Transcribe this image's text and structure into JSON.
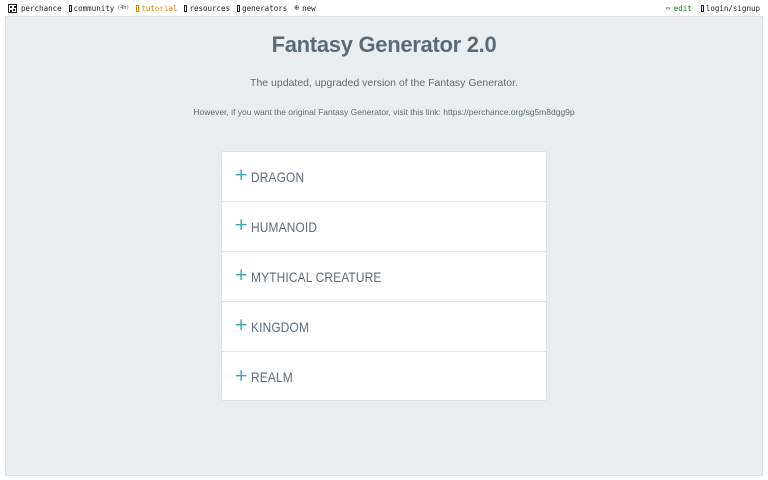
{
  "topbar": {
    "brand": "perchance",
    "community": "community",
    "community_badge": "(4h)",
    "tutorial": "tutorial",
    "resources": "resources",
    "generators": "generators",
    "new": "new",
    "edit": "edit",
    "login": "login/signup"
  },
  "page": {
    "title": "Fantasy Generator 2.0",
    "subtitle": "The updated, upgraded version of the Fantasy Generator.",
    "note_prefix": "However, if you want the original Fantasy Generator, visit this link: ",
    "note_link": "https://perchance.org/sg5m8dgg9p"
  },
  "accordion": {
    "items": [
      {
        "label": "DRAGON"
      },
      {
        "label": "HUMANOID"
      },
      {
        "label": "MYTHICAL CREATURE"
      },
      {
        "label": "KINGDOM"
      },
      {
        "label": "REALM"
      }
    ]
  },
  "colors": {
    "accent": "#3aa3b8",
    "panel_bg": "#ebeef1",
    "title_text": "#5a6b78",
    "tutorial": "#e68a00",
    "edit": "#1d7a1d"
  },
  "icons": {
    "brand": "dice-icon",
    "community": "chat-icon",
    "tutorial": "book-icon",
    "resources": "book-icon",
    "generators": "book-icon",
    "new": "plus-circle-icon",
    "edit": "pencil-icon",
    "login": "user-icon",
    "accordion": "plus-icon"
  }
}
